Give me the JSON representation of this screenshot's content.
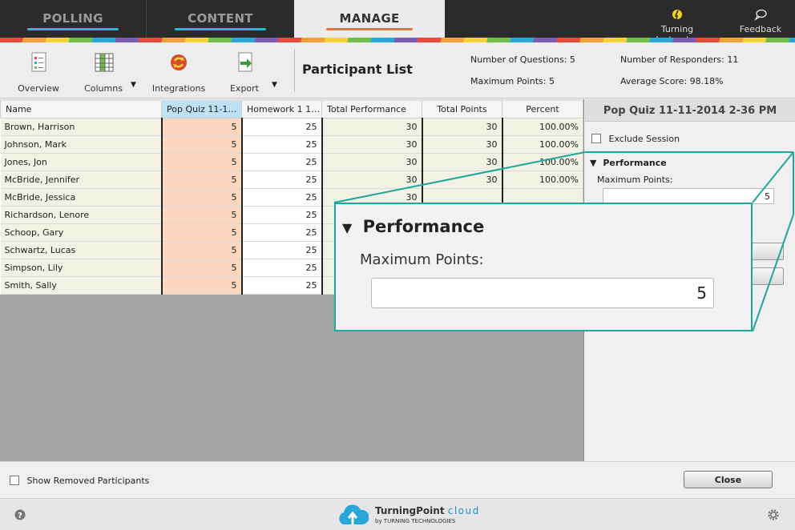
{
  "nav": {
    "tabs": [
      {
        "label": "POLLING"
      },
      {
        "label": "CONTENT"
      },
      {
        "label": "MANAGE"
      }
    ],
    "instructor": "Turning Instructor",
    "feedback": "Feedback"
  },
  "toolbar": {
    "overview": "Overview",
    "columns": "Columns",
    "integrations": "Integrations",
    "export": "Export",
    "title": "Participant List"
  },
  "stats": {
    "num_questions": "Number of Questions: 5",
    "max_points": "Maximum Points: 5",
    "num_responders": "Number of Responders: 11",
    "avg_score": "Average Score: 98.18%"
  },
  "table": {
    "headers": [
      "Name",
      "Pop Quiz 11-11...",
      "Homework 1 11...",
      "Total Performance",
      "Total Points",
      "Percent"
    ],
    "rows": [
      {
        "name": "Brown, Harrison",
        "quiz": "5",
        "hw": "25",
        "perf": "30",
        "points": "30",
        "pct": "100.00%"
      },
      {
        "name": "Johnson, Mark",
        "quiz": "5",
        "hw": "25",
        "perf": "30",
        "points": "30",
        "pct": "100.00%"
      },
      {
        "name": "Jones, Jon",
        "quiz": "5",
        "hw": "25",
        "perf": "30",
        "points": "30",
        "pct": "100.00%"
      },
      {
        "name": "McBride, Jennifer",
        "quiz": "5",
        "hw": "25",
        "perf": "30",
        "points": "30",
        "pct": "100.00%"
      },
      {
        "name": "McBride, Jessica",
        "quiz": "5",
        "hw": "25",
        "perf": "30",
        "points": "",
        "pct": ""
      },
      {
        "name": "Richardson, Lenore",
        "quiz": "5",
        "hw": "25",
        "perf": "",
        "points": "",
        "pct": ""
      },
      {
        "name": "Schoop, Gary",
        "quiz": "5",
        "hw": "25",
        "perf": "",
        "points": "",
        "pct": ""
      },
      {
        "name": "Schwartz, Lucas",
        "quiz": "5",
        "hw": "25",
        "perf": "",
        "points": "",
        "pct": ""
      },
      {
        "name": "Simpson, Lily",
        "quiz": "5",
        "hw": "25",
        "perf": "",
        "points": "",
        "pct": ""
      },
      {
        "name": "Smith, Sally",
        "quiz": "5",
        "hw": "25",
        "perf": "",
        "points": "",
        "pct": ""
      }
    ]
  },
  "panel": {
    "title": "Pop Quiz 11-11-2014 2-36 PM",
    "exclude": "Exclude Session",
    "performance": "Performance",
    "max_points_label": "Maximum Points:",
    "max_points_value": "5"
  },
  "callout": {
    "performance": "Performance",
    "max_points_label": "Maximum Points:",
    "max_points_value": "5"
  },
  "bottom": {
    "show_removed": "Show Removed Participants",
    "close": "Close"
  },
  "footer": {
    "brand": "TurningPoint",
    "brand_cloud": "cloud",
    "by": "by TURNING TECHNOLOGIES"
  },
  "colors": {
    "accent_teal": "#1fa79a",
    "manage_underline": "#e8762d",
    "nav_underline": "#2bb5d8",
    "quiz_column": "#fbd7be"
  }
}
